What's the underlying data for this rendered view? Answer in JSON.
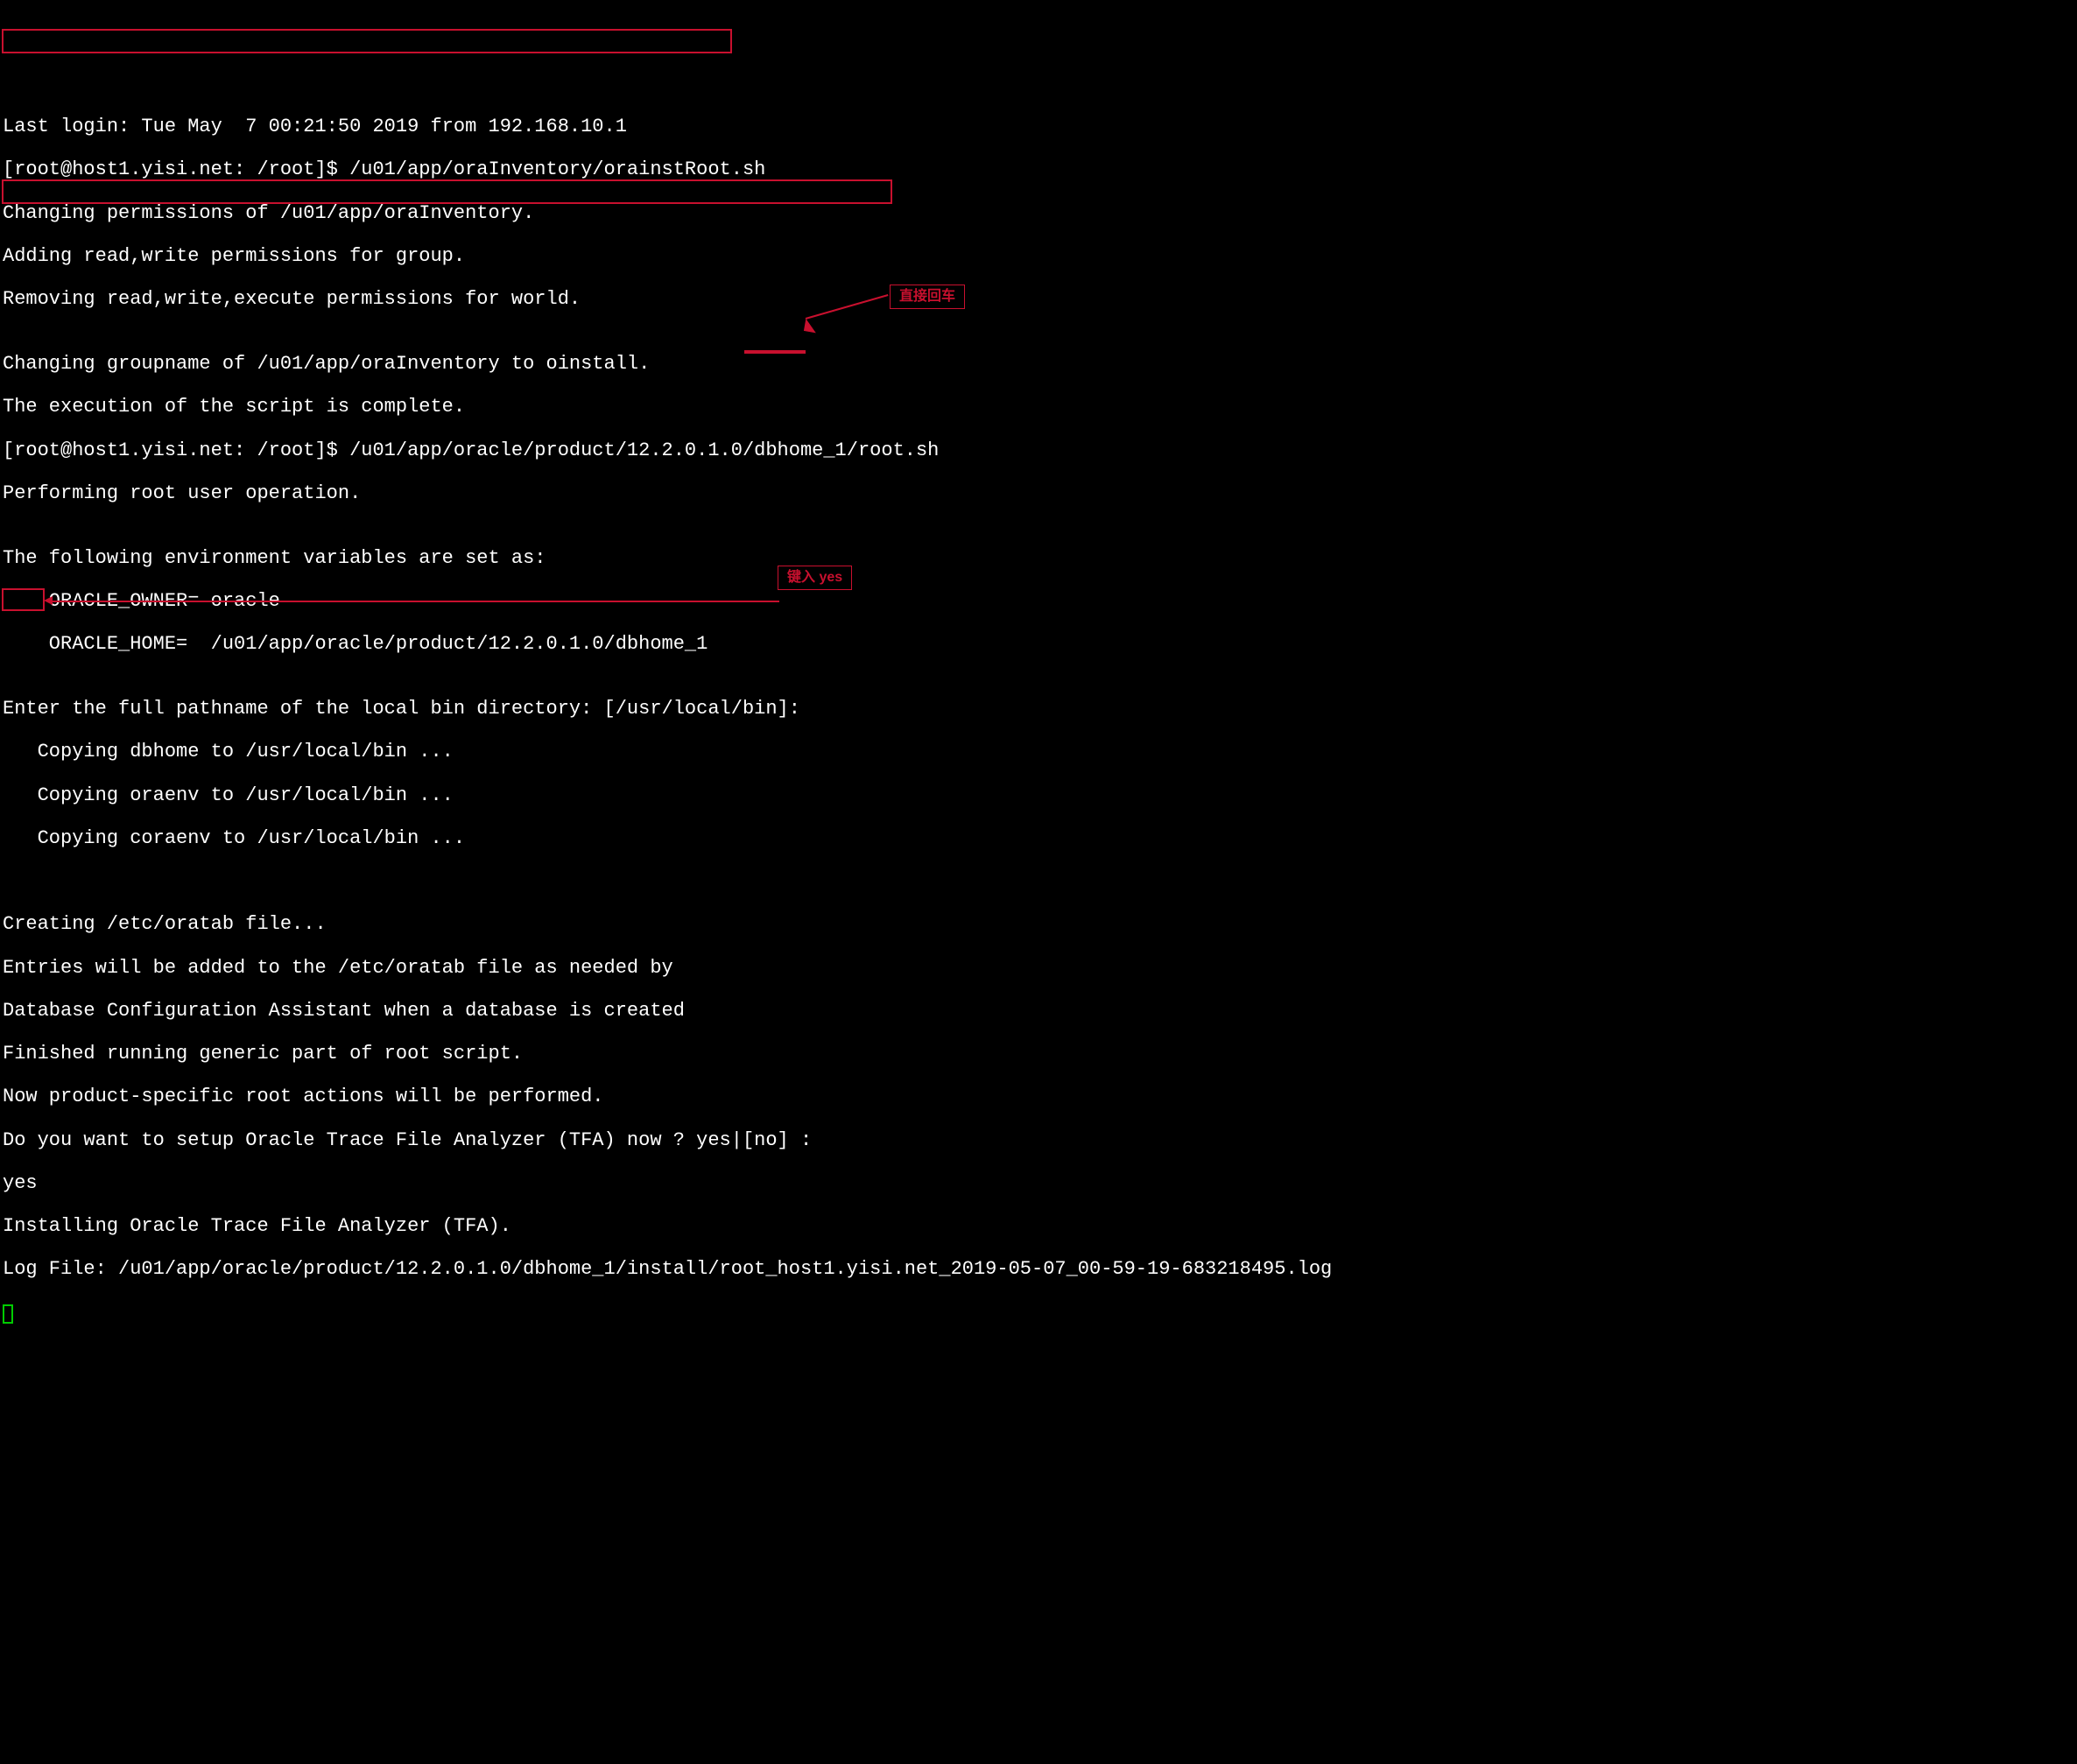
{
  "terminal": {
    "lines": {
      "lastLogin": "Last login: Tue May  7 00:21:50 2019 from 192.168.10.1",
      "prompt1": "[root@host1.yisi.net: /root]$ /u01/app/oraInventory/orainstRoot.sh",
      "changingPerms": "Changing permissions of /u01/app/oraInventory.",
      "addingPerms": "Adding read,write permissions for group.",
      "removingPerms": "Removing read,write,execute permissions for world.",
      "blank1": "",
      "changingGroup": "Changing groupname of /u01/app/oraInventory to oinstall.",
      "execComplete": "The execution of the script is complete.",
      "prompt2": "[root@host1.yisi.net: /root]$ /u01/app/oracle/product/12.2.0.1.0/dbhome_1/root.sh",
      "performingRoot": "Performing root user operation.",
      "blank2": "",
      "envVars": "The following environment variables are set as:",
      "oracleOwner": "    ORACLE_OWNER= oracle",
      "oracleHome": "    ORACLE_HOME=  /u01/app/oracle/product/12.2.0.1.0/dbhome_1",
      "blank3": "",
      "enterPath": "Enter the full pathname of the local bin directory: [/usr/local/bin]: ",
      "copyDbhome": "   Copying dbhome to /usr/local/bin ...",
      "copyOraenv": "   Copying oraenv to /usr/local/bin ...",
      "copyCoraenv": "   Copying coraenv to /usr/local/bin ...",
      "blank4": "",
      "blank5": "",
      "creatingOratab": "Creating /etc/oratab file...",
      "entriesAdded": "Entries will be added to the /etc/oratab file as needed by",
      "dbConfig": "Database Configuration Assistant when a database is created",
      "finishedGeneric": "Finished running generic part of root script.",
      "nowProduct": "Now product-specific root actions will be performed.",
      "tfaPrompt": "Do you want to setup Oracle Trace File Analyzer (TFA) now ? yes|[no] :",
      "yes": "yes",
      "installingTFA": "Installing Oracle Trace File Analyzer (TFA).",
      "logFile": "Log File: /u01/app/oracle/product/12.2.0.1.0/dbhome_1/install/root_host1.yisi.net_2019-05-07_00-59-19-683218495.log"
    }
  },
  "annotations": {
    "label1": "直接回车",
    "label2": "键入 yes"
  }
}
